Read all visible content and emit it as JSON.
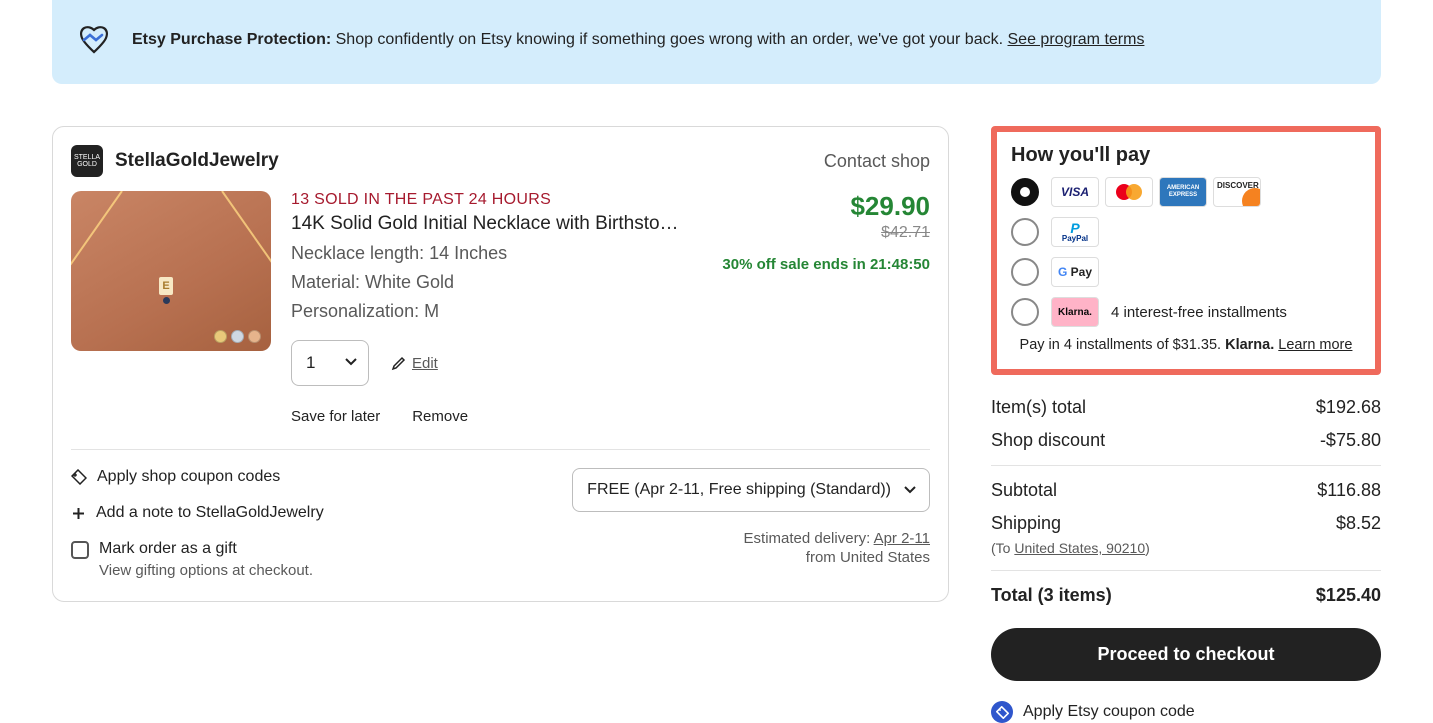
{
  "banner": {
    "bold": "Etsy Purchase Protection:",
    "text": " Shop confidently on Etsy knowing if something goes wrong with an order, we've got your back. ",
    "link": "See program terms"
  },
  "shop": {
    "name": "StellaGoldJewelry",
    "contact": "Contact shop"
  },
  "item": {
    "soldBadge": "13 SOLD IN THE PAST 24 HOURS",
    "title": "14K Solid Gold Initial Necklace with Birthsto…",
    "attr1Label": "Necklace length:",
    "attr1Val": " 14 Inches",
    "attr2Label": "Material:",
    "attr2Val": " White Gold",
    "attr3Label": "Personalization:",
    "attr3Val": " M",
    "qty": "1",
    "edit": "Edit",
    "save": "Save for later",
    "remove": "Remove",
    "price": "$29.90",
    "origPrice": "$42.71",
    "saleEnds": "30% off sale ends in 21:48:50"
  },
  "shopActions": {
    "coupon": "Apply shop coupon codes",
    "addNote": "Add a note to StellaGoldJewelry",
    "shipOption": "FREE (Apr 2-11, Free shipping (Standard))",
    "estDelLabel": "Estimated delivery: ",
    "estDelDate": "Apr 2-11",
    "from": "from United States",
    "giftLabel": "Mark order as a gift",
    "giftSub": "View gifting options at checkout."
  },
  "pay": {
    "title": "How you'll pay",
    "installments": "4 interest-free installments",
    "klarnaLine1": "Pay in 4 installments of $31.35. ",
    "klarnaBrand": "Klarna.",
    "klarnaLearn": "Learn more"
  },
  "totals": {
    "itemsLabel": "Item(s) total",
    "itemsVal": "$192.68",
    "discountLabel": "Shop discount",
    "discountVal": "-$75.80",
    "subtotalLabel": "Subtotal",
    "subtotalVal": "$116.88",
    "shippingLabel": "Shipping",
    "shippingVal": "$8.52",
    "shipToPrefix": "(To ",
    "shipToLink": "United States, 90210",
    "shipToSuffix": ")",
    "totalLabel": "Total (3 items)",
    "totalVal": "$125.40",
    "checkout": "Proceed to checkout",
    "etsyCoupon": "Apply Etsy coupon code"
  }
}
